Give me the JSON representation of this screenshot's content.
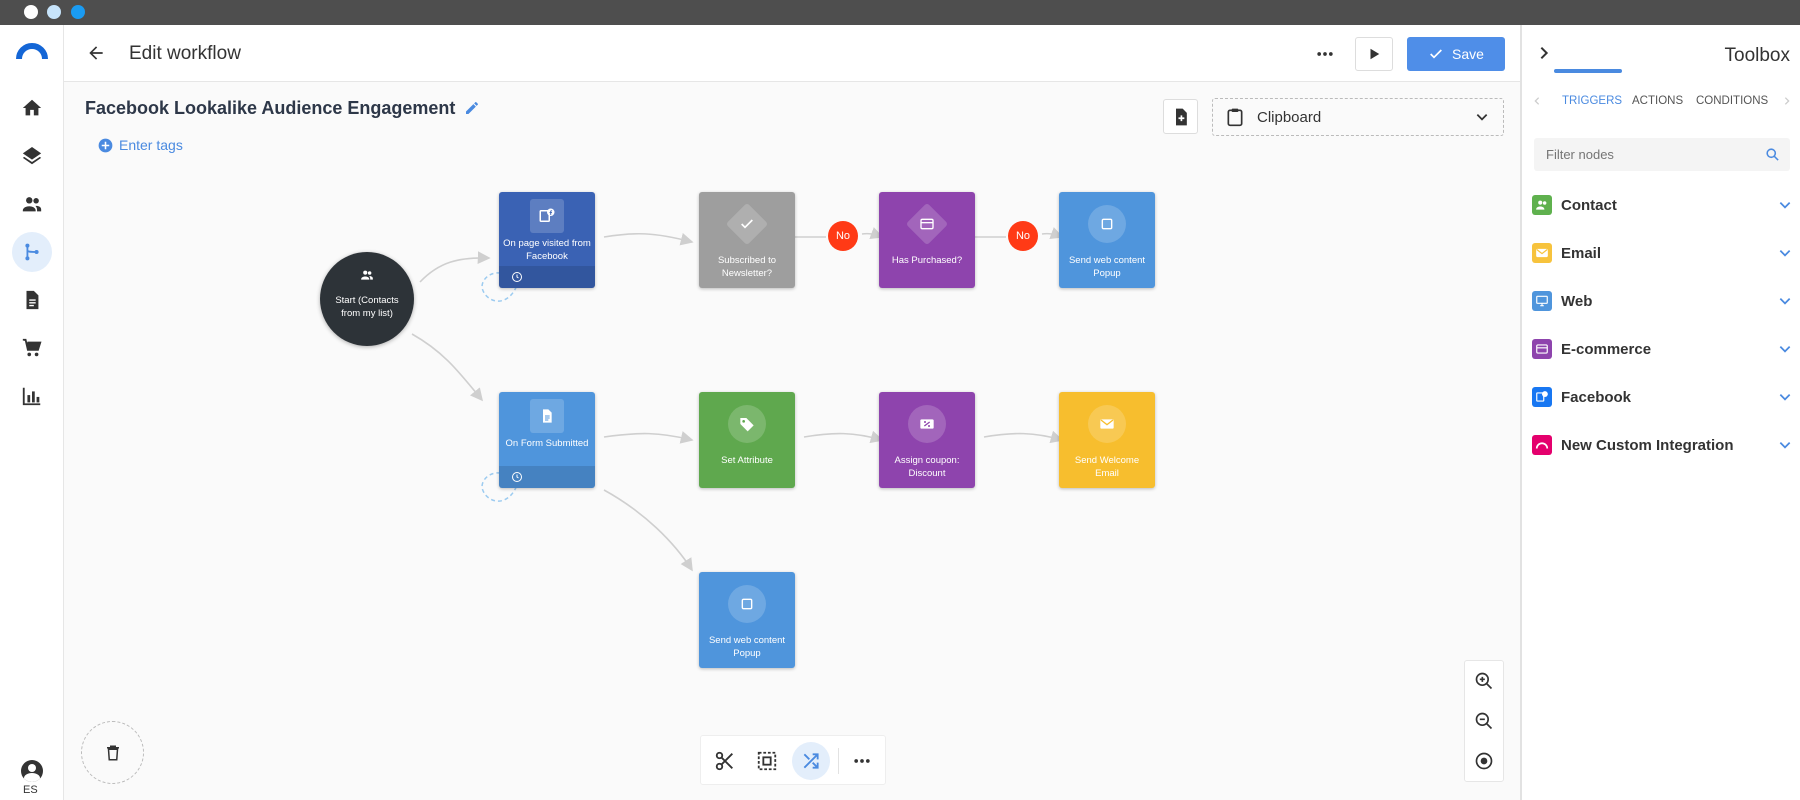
{
  "window": {
    "dots": [
      "#ffffff",
      "#c7e4fb",
      "#1a9bf2"
    ]
  },
  "header": {
    "title": "Edit workflow",
    "save_label": "Save"
  },
  "workflow": {
    "name": "Facebook Lookalike Audience Engagement",
    "tags_placeholder": "Enter tags"
  },
  "clipboard": {
    "label": "Clipboard"
  },
  "nodes": {
    "start": "Start (Contacts from my list)",
    "fb_visit": "On page visited from Facebook",
    "subscribed": "Subscribed to Newsletter?",
    "purchased": "Has Purchased?",
    "popup1": "Send web content Popup",
    "form": "On Form Submitted",
    "attribute": "Set Attribute",
    "coupon": "Assign coupon: Discount",
    "welcome": "Send Welcome Email",
    "popup2": "Send web content Popup",
    "no1": "No",
    "no2": "No"
  },
  "toolbox": {
    "title": "Toolbox",
    "tabs": [
      "TRIGGERS",
      "ACTIONS",
      "CONDITIONS"
    ],
    "filter_placeholder": "Filter nodes",
    "categories": [
      {
        "label": "Contact",
        "color": "#5fb14e"
      },
      {
        "label": "Email",
        "color": "#f7c33d"
      },
      {
        "label": "Web",
        "color": "#4f95dc"
      },
      {
        "label": "E-commerce",
        "color": "#8e44ad"
      },
      {
        "label": "Facebook",
        "color": "#1877f2"
      },
      {
        "label": "New Custom Integration",
        "color": "#e4006d"
      }
    ]
  },
  "user": {
    "locale": "ES"
  }
}
